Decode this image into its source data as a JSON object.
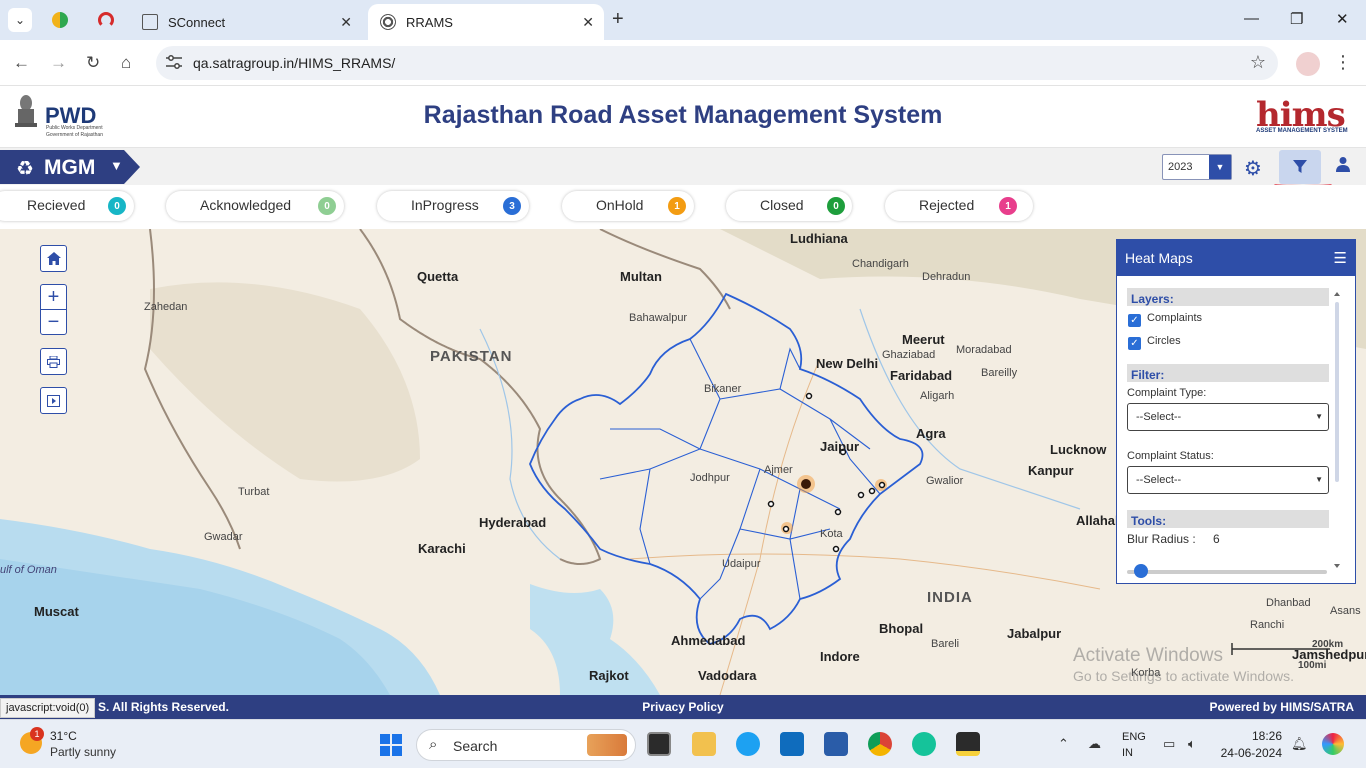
{
  "browser": {
    "tabs": [
      {
        "label": "SConnect",
        "active": false
      },
      {
        "label": "RRAMS",
        "active": true
      }
    ],
    "url": "qa.satragroup.in/HIMS_RRAMS/"
  },
  "header": {
    "pwd_title": "PWD",
    "pwd_sub1": "Public Works Department",
    "pwd_sub2": "Government of Rajasthan",
    "app_title": "Rajasthan Road Asset Management System",
    "hims_logo": "hims",
    "hims_sub": "ASSET MANAGEMENT SYSTEM"
  },
  "module": {
    "label": "MGM",
    "year": "2023"
  },
  "statuses": [
    {
      "label": "Recieved",
      "count": "0",
      "color": "#17b6c6"
    },
    {
      "label": "Acknowledged",
      "count": "0",
      "color": "#8fce93"
    },
    {
      "label": "InProgress",
      "count": "3",
      "color": "#2a6ed6"
    },
    {
      "label": "OnHold",
      "count": "1",
      "color": "#f39c12"
    },
    {
      "label": "Closed",
      "count": "0",
      "color": "#1e9e3c"
    },
    {
      "label": "Rejected",
      "count": "1",
      "color": "#e83e8c"
    }
  ],
  "map": {
    "labels": {
      "ludhiana": "Ludhiana",
      "chandigarh": "Chandigarh",
      "dehradun": "Dehradun",
      "quetta": "Quetta",
      "multan": "Multan",
      "bahawalpur": "Bahawalpur",
      "zahedan": "Zahedan",
      "pakistan": "PAKISTAN",
      "meerut": "Meerut",
      "newdelhi": "New Delhi",
      "ghaziabad": "Ghaziabad",
      "moradabad": "Moradabad",
      "faridabad": "Faridabad",
      "bareilly": "Bareilly",
      "bikaner": "Bikaner",
      "aligarh": "Aligarh",
      "jaipur": "Jaipur",
      "agra": "Agra",
      "lucknow": "Lucknow",
      "ajmer": "Ajmer",
      "jodhpur": "Jodhpur",
      "kanpur": "Kanpur",
      "gwalior": "Gwalior",
      "turbat": "Turbat",
      "hyderabad": "Hyderabad",
      "allahabad": "Allahab",
      "kota": "Kota",
      "gwadar": "Gwadar",
      "karachi": "Karachi",
      "udaipur": "Udaipur",
      "gulfofoman": "ulf of Oman",
      "india": "INDIA",
      "muscat": "Muscat",
      "dhanbad": "Dhanbad",
      "asansol": "Asans",
      "ranchi": "Ranchi",
      "ahmedabad": "Ahmedabad",
      "bhopal": "Bhopal",
      "jabalpur": "Jabalpur",
      "bareli": "Bareli",
      "indore": "Indore",
      "jamshedpur": "Jamshedpur",
      "rajkot": "Rajkot",
      "vadodara": "Vadodara",
      "korba": "Korba",
      "scale_km": "200km",
      "scale_mi": "100mi"
    }
  },
  "heatmap": {
    "title": "Heat Maps",
    "layers_label": "Layers:",
    "layer_items": [
      "Complaints",
      "Circles"
    ],
    "filter_label": "Filter:",
    "complaint_type_label": "Complaint Type:",
    "complaint_type_value": "--Select--",
    "complaint_status_label": "Complaint Status:",
    "complaint_status_value": "--Select--",
    "tools_label": "Tools:",
    "blur_label": "Blur Radius :",
    "blur_value": "6"
  },
  "footer": {
    "left": "S. All Rights Reserved.",
    "center": "Privacy Policy",
    "right": "Powered by HIMS/SATRA",
    "status_link": "javascript:void(0)"
  },
  "watermark": {
    "line1": "Activate Windows",
    "line2": "Go to Settings to activate Windows."
  },
  "taskbar": {
    "temp": "31°C",
    "condition": "Partly sunny",
    "weather_badge": "1",
    "search": "Search",
    "lang1": "ENG",
    "lang2": "IN",
    "time": "18:26",
    "date": "24-06-2024"
  }
}
